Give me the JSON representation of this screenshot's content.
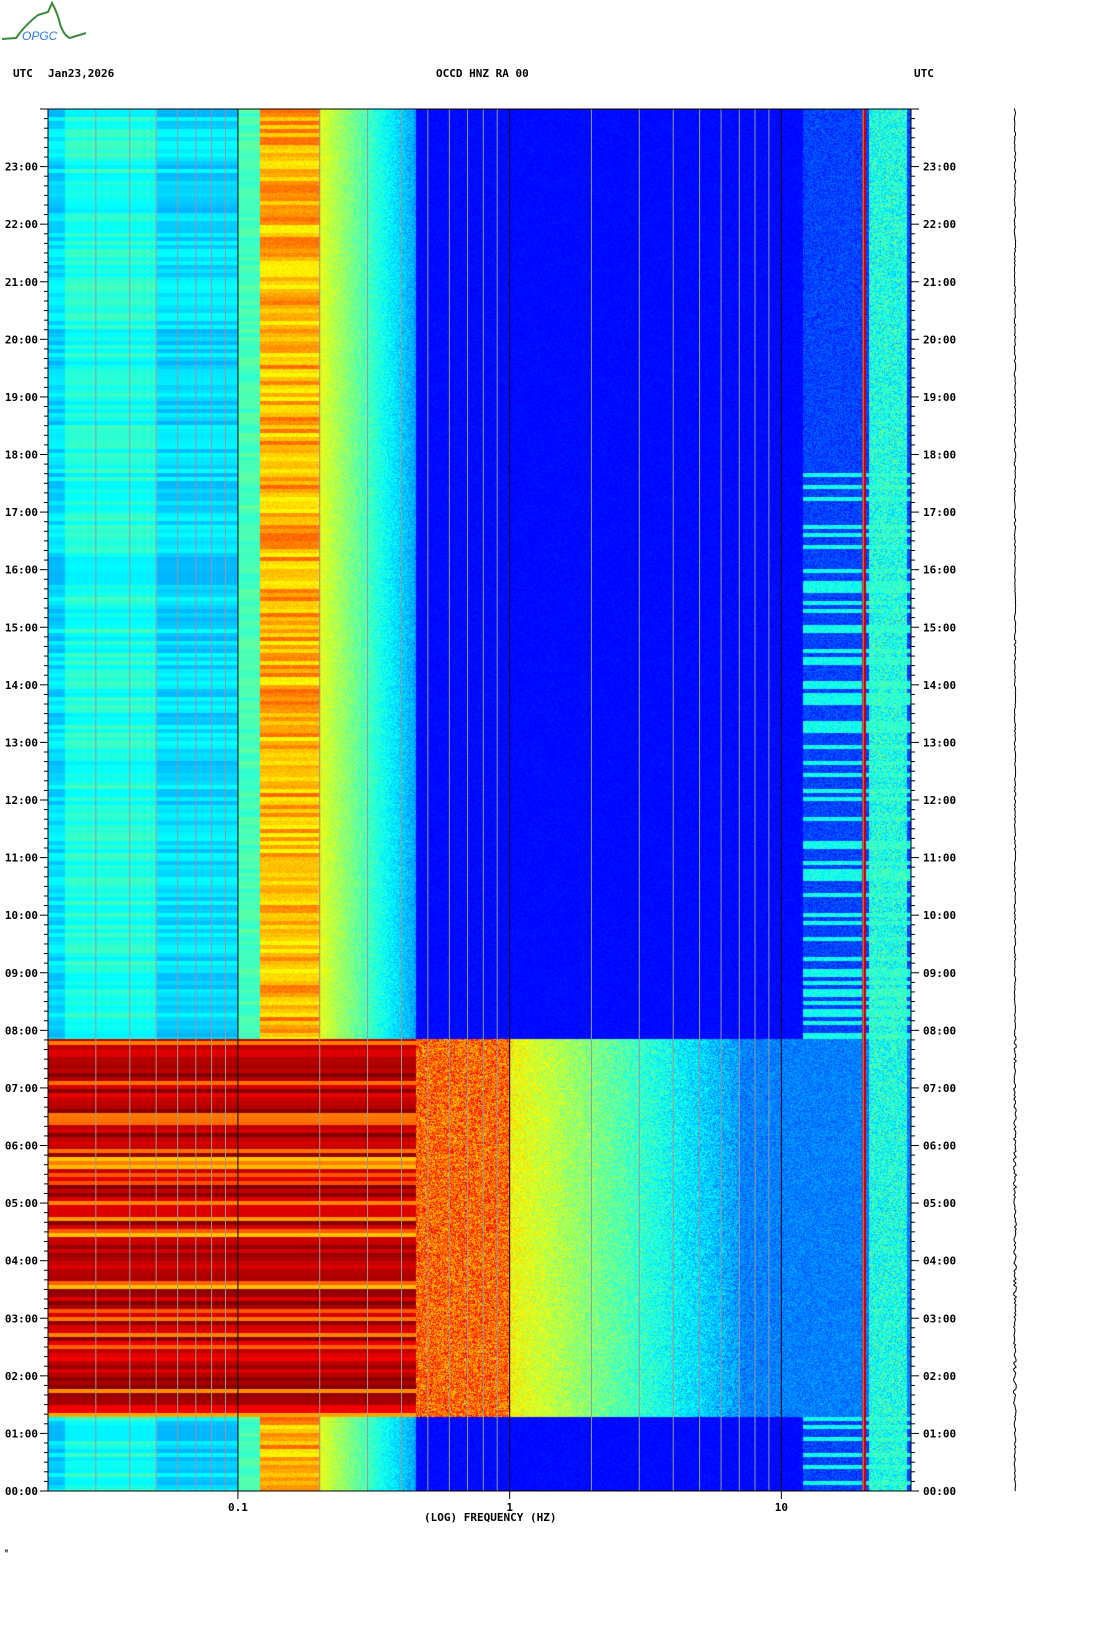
{
  "header": {
    "left_tz": "UTC",
    "date": "Jan23,2026",
    "station": "OCCD HNZ RA 00",
    "right_tz": "UTC"
  },
  "logo_text": "OPGC",
  "footer_mark": "ᴹ",
  "chart_data": {
    "type": "heatmap",
    "title": "OCCD HNZ RA 00",
    "xlabel": "(LOG) FREQUENCY (HZ)",
    "ylabel": "UTC",
    "xscale": "log",
    "xlim": [
      0.02,
      30
    ],
    "ylim_hours": [
      0,
      24
    ],
    "x_ticks": [
      {
        "value": 0.1,
        "label": "0.1"
      },
      {
        "value": 1,
        "label": "1"
      },
      {
        "value": 10,
        "label": "10"
      }
    ],
    "y_ticks": [
      "00:00",
      "01:00",
      "02:00",
      "03:00",
      "04:00",
      "05:00",
      "06:00",
      "07:00",
      "08:00",
      "09:00",
      "10:00",
      "11:00",
      "12:00",
      "13:00",
      "14:00",
      "15:00",
      "16:00",
      "17:00",
      "18:00",
      "19:00",
      "20:00",
      "21:00",
      "22:00",
      "23:00"
    ],
    "colormap": "jet",
    "features": [
      {
        "name": "microseism peak",
        "freq_range_hz": [
          0.12,
          0.2
        ],
        "level": "high"
      },
      {
        "name": "strong event",
        "time_range_hours": [
          1.3,
          7.85
        ],
        "freq_range_hz": [
          0.02,
          6
        ],
        "level": "saturated"
      },
      {
        "name": "persistent line",
        "freq_hz": 20,
        "level": "high"
      }
    ]
  }
}
